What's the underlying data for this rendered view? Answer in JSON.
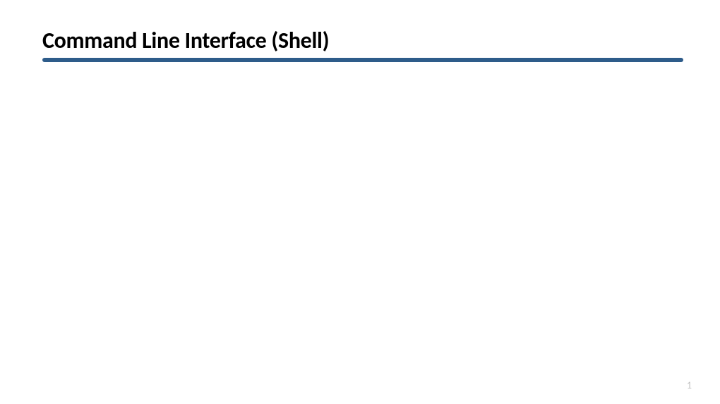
{
  "slide": {
    "title": "Command Line Interface (Shell)",
    "page_number": "1"
  },
  "colors": {
    "underline": "#2e5c8a",
    "page_number": "#bfbfbf"
  }
}
